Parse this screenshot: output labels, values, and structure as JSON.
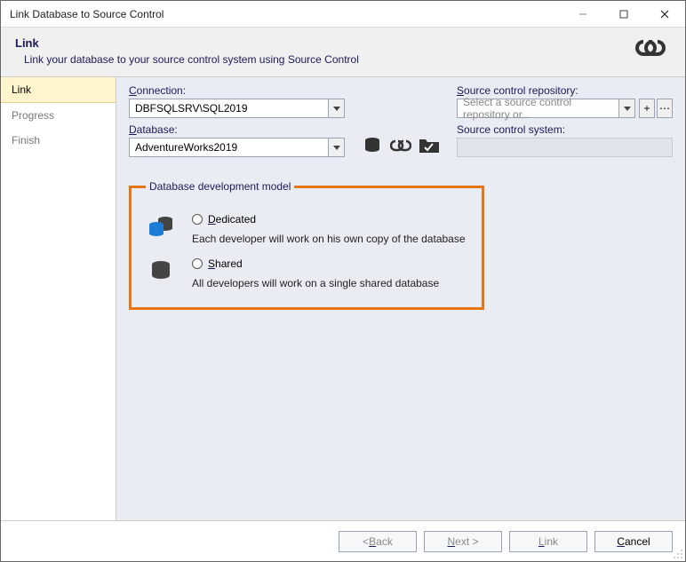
{
  "window": {
    "title": "Link Database to Source Control"
  },
  "header": {
    "title": "Link",
    "description": "Link your database to your source control system using Source Control"
  },
  "sidebar": {
    "items": [
      {
        "label": "Link",
        "active": true
      },
      {
        "label": "Progress",
        "active": false
      },
      {
        "label": "Finish",
        "active": false
      }
    ]
  },
  "left_panel": {
    "connection_label_pre": "C",
    "connection_label_rest": "onnection:",
    "connection_value": "DBFSQLSRV\\SQL2019",
    "database_label_pre": "D",
    "database_label_rest": "atabase:",
    "database_value": "AdventureWorks2019"
  },
  "right_panel": {
    "repo_label_pre": "S",
    "repo_label_rest": "ource control repository:",
    "repo_placeholder": "Select a source control repository or...",
    "system_label": "Source control system:"
  },
  "dev_model": {
    "legend": "Database development model",
    "dedicated": {
      "pre": "D",
      "rest": "edicated",
      "desc": "Each developer will work on his own copy of the database"
    },
    "shared": {
      "pre": "S",
      "rest": "hared",
      "desc": "All developers will work on a single shared database"
    }
  },
  "footer": {
    "back_pre": "< ",
    "back_u": "B",
    "back_rest": "ack",
    "next_u": "N",
    "next_rest": "ext >",
    "link_u": "L",
    "link_rest": "ink",
    "cancel_u": "C",
    "cancel_rest": "ancel"
  }
}
